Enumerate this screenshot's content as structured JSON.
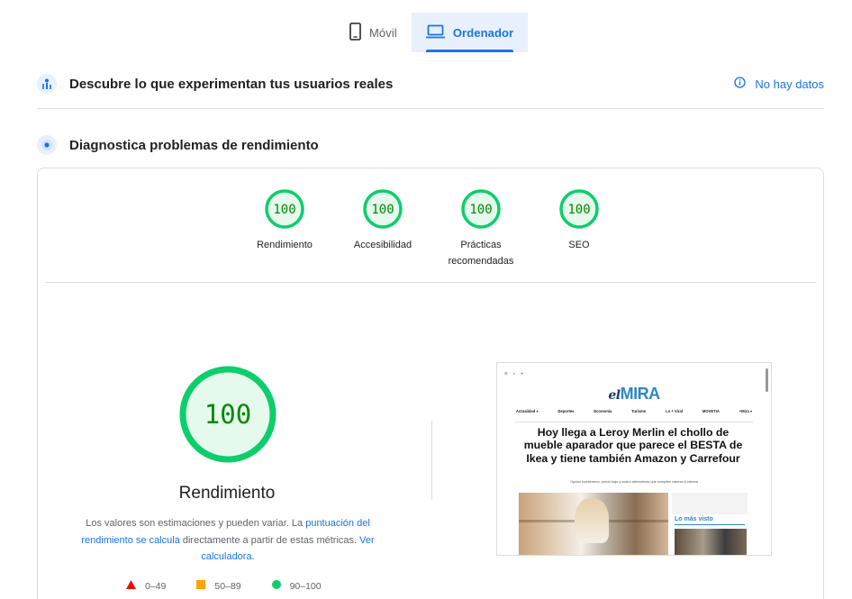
{
  "tabs": [
    {
      "label": "Móvil",
      "icon": "phone-icon",
      "active": false
    },
    {
      "label": "Ordenador",
      "icon": "laptop-icon",
      "active": true
    }
  ],
  "field_data": {
    "title": "Descubre lo que experimentan tus usuarios reales",
    "status": "No hay datos"
  },
  "lab": {
    "title": "Diagnostica problemas de rendimiento",
    "categories": [
      {
        "label": "Rendimiento",
        "score": "100"
      },
      {
        "label": "Accesibilidad",
        "score": "100"
      },
      {
        "label": "Prácticas recomendadas",
        "score": "100"
      },
      {
        "label": "SEO",
        "score": "100"
      }
    ],
    "main_score": "100",
    "main_label": "Rendimiento",
    "desc_1": "Los valores son estimaciones y pueden variar. La ",
    "desc_link_1": "puntuación del rendimiento se calcula",
    "desc_2": " directamente a partir de estas métricas. ",
    "desc_link_2": "Ver calculadora.",
    "legend": [
      {
        "range": "0–49",
        "shape": "triangle",
        "color": "#eb0f00"
      },
      {
        "range": "50–89",
        "shape": "square",
        "color": "#ffa400"
      },
      {
        "range": "90–100",
        "shape": "circle",
        "color": "#0cce6b"
      }
    ],
    "colors": {
      "pass": "#0cce6b",
      "pass_text": "#008800",
      "pass_bg": "#e6f9ed"
    }
  },
  "screenshot": {
    "logo_prefix": "el",
    "logo_main": "MIRA",
    "nav": [
      "Actualidad ▾",
      "Deportes",
      "Economía",
      "Turismo",
      "Lo + Viral",
      "MOVETIA",
      "+Mira ▾"
    ],
    "headline": "Hoy llega a Leroy Merlin el chollo de mueble aparador que parece el BESTA de Ikea y tiene también Amazon y Carrefour",
    "subtitle": "Opción todoterreno, precio bajo y cuatro alternativas que compiten cabeza a cabeza",
    "most_viewed": "Lo más visto"
  }
}
